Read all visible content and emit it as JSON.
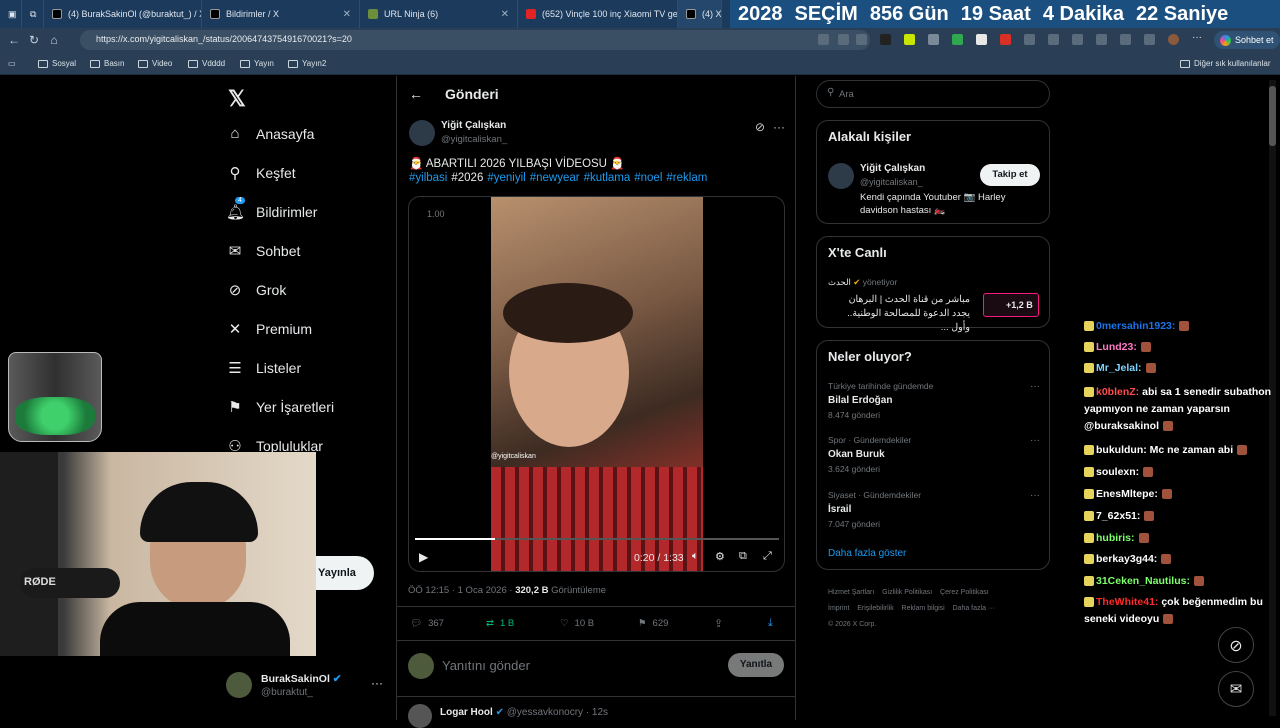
{
  "tabs": [
    {
      "title": "(4) BurakSakinOl (@buraktut_) / X",
      "icon": "x-icon"
    },
    {
      "title": "Bildirimler / X",
      "icon": "x-icon"
    },
    {
      "title": "URL Ninja (6)",
      "icon": "url-ninja-icon"
    },
    {
      "title": "(652) Vinçle 100 inç Xiaomi TV geti",
      "icon": "youtube-icon"
    },
    {
      "title": "(4) X'",
      "icon": "x-icon"
    }
  ],
  "countdown": [
    "2028",
    "SEÇİM",
    "856 Gün",
    "19 Saat",
    "4  Dakika",
    "22 Saniye"
  ],
  "url": "https://x.com/yigitcaliskan_/status/2006474375491670021?s=20",
  "chat_button": "Sohbet et",
  "bookmarks": [
    "Sosyal",
    "Basın",
    "Video",
    "Vdddd",
    "Yayın",
    "Yayın2"
  ],
  "bookmarks_other": "Diğer sık kullanılanlar",
  "nav": [
    "Anasayfa",
    "Keşfet",
    "Bildirimler",
    "Sohbet",
    "Grok",
    "Premium",
    "Listeler",
    "Yer İşaretleri",
    "Topluluklar"
  ],
  "notif_count": "4",
  "post_button": "Yayınla",
  "account": {
    "name": "BurakSakinOl",
    "handle": "@buraktut_"
  },
  "main_title": "Gönderi",
  "tweet": {
    "author": "Yiğit Çalışkan",
    "handle": "@yigitcaliskan_",
    "text": "🎅 ABARTILI 2026 YILBAŞI VİDEOSU 🎅",
    "tags": [
      "#yilbasi",
      "#2026",
      "#yeniyil",
      "#newyear",
      "#kutlama",
      "#noel",
      "#reklam"
    ],
    "video_badge": "1.00",
    "watermark": "@yigitcaliskan",
    "time": "0:20 / 1:33",
    "progress": 0.22,
    "meta": "ÖÖ 12:15 · 1 Oca 2026 · ",
    "views": "320,2 B",
    "views_label": "Görüntüleme",
    "replies": "367",
    "retweets": "1 B",
    "likes": "10 B",
    "bookmarks": "629"
  },
  "reply_placeholder": "Yanıtını gönder",
  "reply_button": "Yanıtla",
  "next_tweet": {
    "author": "Logar Hool",
    "handle": "@yessavkonocry",
    "time": "· 12s"
  },
  "search_placeholder": "Ara",
  "related": {
    "title": "Alakalı kişiler",
    "name": "Yiğit Çalışkan",
    "handle": "@yigitcaliskan_",
    "bio": "Kendi çapında Youtuber 📷 Harley davidson hastası 🏍️",
    "follow": "Takip et"
  },
  "live": {
    "title": "X'te Canlı",
    "host": "الحدث",
    "host_suffix": "yönetiyor",
    "text": "مباشر من قناة الحدث | البرهان يجدد الدعوة للمصالحة الوطنية.. وأول ...",
    "count": "+1,2 B"
  },
  "trends": {
    "title": "Neler oluyor?",
    "items": [
      {
        "context": "Türkiye tarihinde gündemde",
        "name": "Bilal Erdoğan",
        "posts": "8.474 gönderi"
      },
      {
        "context": "Spor · Gündemdekiler",
        "name": "Okan Buruk",
        "posts": "3.624 gönderi"
      },
      {
        "context": "Siyaset · Gündemdekiler",
        "name": "İsrail",
        "posts": "7.047 gönderi"
      }
    ],
    "more": "Daha fazla göster"
  },
  "footer": [
    "Hizmet Şartları",
    "Gizlilik Politikası",
    "Çerez Politikası",
    "İmprint",
    "Erişilebilirlik",
    "Reklam bilgisi",
    "Daha fazla ···",
    "© 2026 X Corp."
  ],
  "chat": [
    {
      "user": "0mersahin1923:",
      "msg": "",
      "color": "#1a73e8"
    },
    {
      "user": "Lund23:",
      "msg": "",
      "color": "#ff7ac8"
    },
    {
      "user": "Mr_Jelal:",
      "msg": "",
      "color": "#7fd4ff"
    },
    {
      "user": "k0blenZ:",
      "msg": "abi sa 1 senedir subathon yapmıyon ne zaman yaparsın @buraksakinol",
      "color": "#ff4d4d"
    },
    {
      "user": "bukuldun:",
      "msg": "Mc ne zaman abi",
      "color": "#ffffff"
    },
    {
      "user": "soulexn:",
      "msg": "",
      "color": "#ffffff"
    },
    {
      "user": "EnesMltepe:",
      "msg": "",
      "color": "#ffffff"
    },
    {
      "user": "7_62x51:",
      "msg": "",
      "color": "#ffffff"
    },
    {
      "user": "hubiris:",
      "msg": "",
      "color": "#7cff6b"
    },
    {
      "user": "berkay3g44:",
      "msg": "",
      "color": "#ffffff"
    },
    {
      "user": "31Ceken_Nautilus:",
      "msg": "",
      "color": "#7cff6b"
    },
    {
      "user": "TheWhite41:",
      "msg": "çok beğenmedim bu seneki videoyu",
      "color": "#ff2a2a"
    }
  ],
  "colors": {
    "accent": "#1d9bf0",
    "bg": "#000000",
    "chrome": "#1b3a5c"
  },
  "webcam_mic_label": "RØDE"
}
